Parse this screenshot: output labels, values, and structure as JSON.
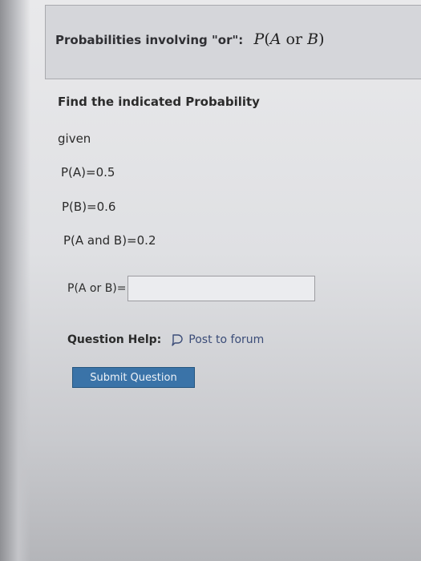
{
  "header": {
    "title": "Probabilities involving \"or\":",
    "formula_prefix": "P",
    "formula_open": "(",
    "formula_a": "A",
    "formula_or": " or ",
    "formula_b": "B",
    "formula_close": ")"
  },
  "question": {
    "instruction": "Find the indicated Probability",
    "given_label": "given",
    "pa": "P(A)=0.5",
    "pb": "P(B)=0.6",
    "pab": "P(A and B)=0.2",
    "answer_label": "P(A or B)=",
    "answer_value": ""
  },
  "help": {
    "label": "Question Help:",
    "forum_link": "Post to forum",
    "forum_icon": "speech-bubble-icon"
  },
  "actions": {
    "submit_label": "Submit Question",
    "accent_color": "#3a73a8"
  }
}
